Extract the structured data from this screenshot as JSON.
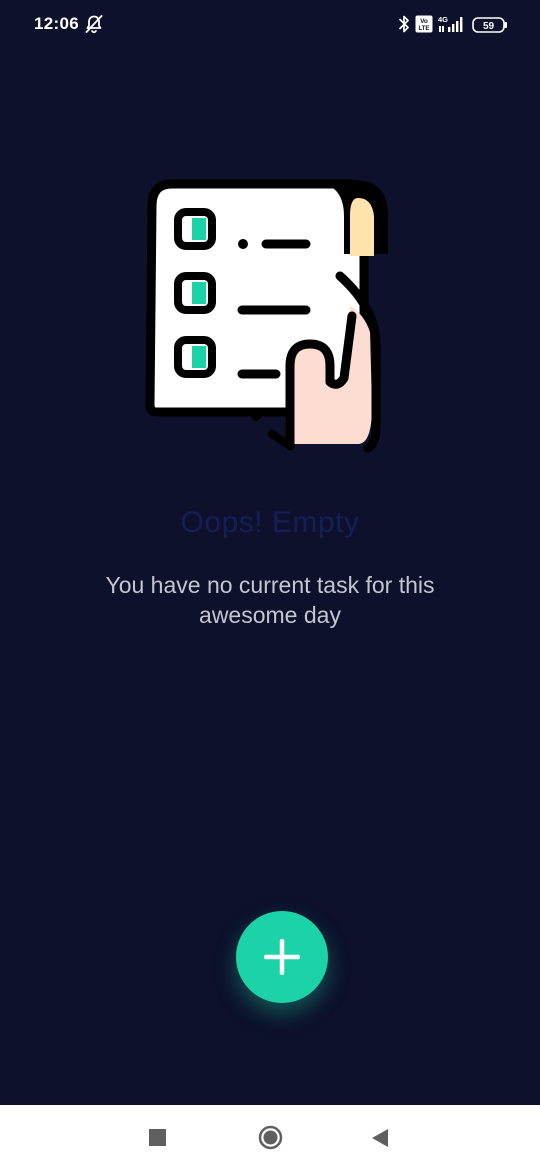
{
  "status_bar": {
    "time": "12:06",
    "icons": [
      "notifications-off-icon",
      "bluetooth-icon",
      "volte-icon",
      "signal-4g-icon",
      "battery-icon"
    ],
    "volte_label": "Vo LTE",
    "network_label": "4G",
    "battery_level": "59"
  },
  "empty_state": {
    "illustration": "checklist-scroll-illustration",
    "title": "Oops! Empty",
    "subtitle": "You have no current task for this awesome day"
  },
  "fab": {
    "icon": "plus-icon",
    "color": "#1bd3a6"
  },
  "nav_bar": {
    "icons": [
      "recent-apps-icon",
      "home-icon",
      "back-icon"
    ]
  },
  "colors": {
    "background": "#0d112b",
    "accent": "#1bd3a6",
    "title": "#181d58",
    "subtitle": "#c5c6cf"
  }
}
